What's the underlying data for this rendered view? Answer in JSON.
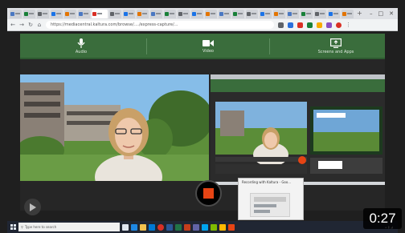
{
  "browser": {
    "tab_count": 25,
    "url": "https://mediacentral.kaltura.com/browse/..../express-capture/..."
  },
  "toolbar": {
    "audio_label": "Audio",
    "video_label": "Video",
    "screens_label": "Screens and Apps"
  },
  "preview_popup": {
    "title": "Recording with Kaltura - Goo..."
  },
  "taskbar": {
    "search_placeholder": "Type here to search"
  },
  "video": {
    "duration": "0:27"
  },
  "colors": {
    "toolbar_green": "#3a6d3c",
    "stop_red": "#e64414",
    "taskbar": "#202633"
  }
}
